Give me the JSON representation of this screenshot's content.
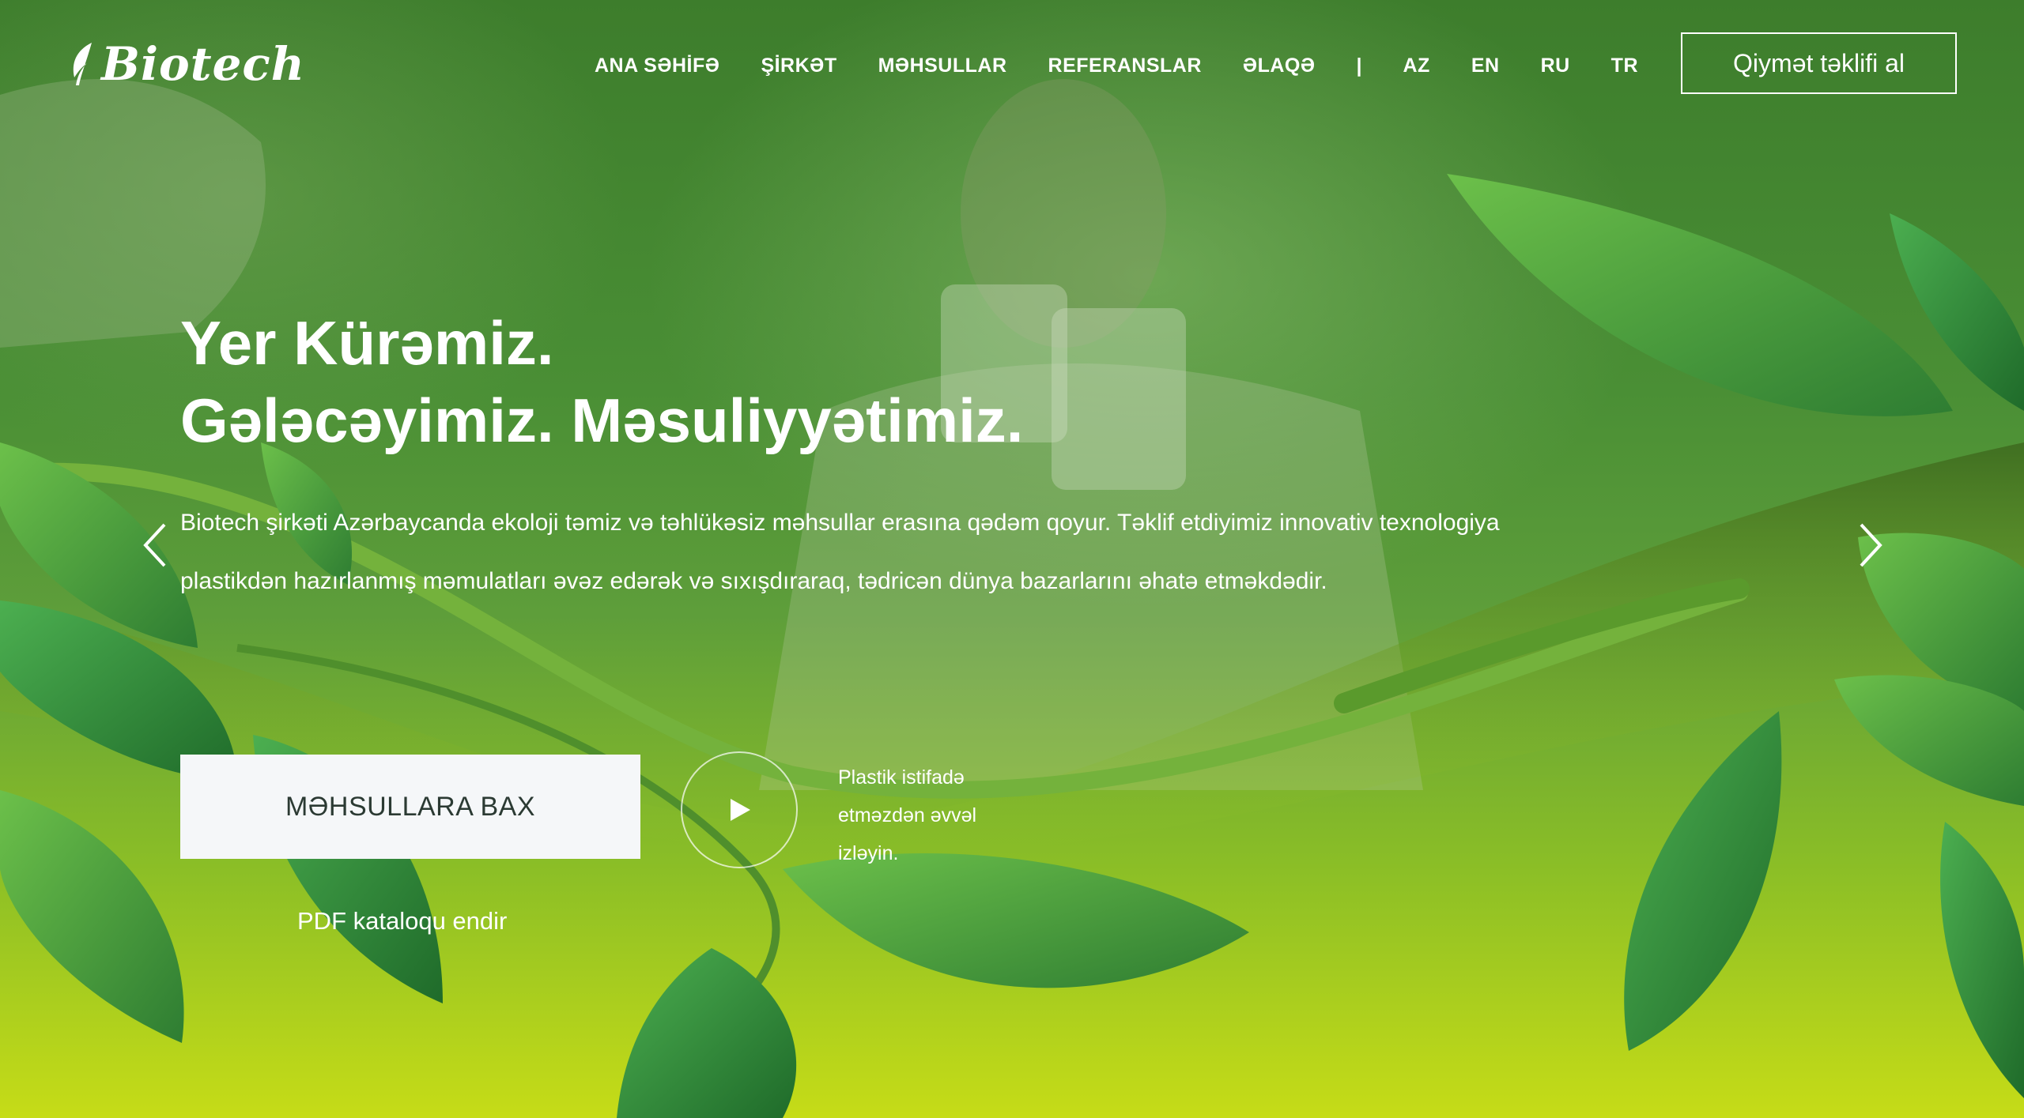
{
  "brand": {
    "name": "Biotech"
  },
  "nav": {
    "items": [
      "ANA SƏHİFƏ",
      "ŞİRKƏT",
      "MƏHSULLAR",
      "REFERANSLAR",
      "ƏLAQƏ"
    ],
    "separator": "|",
    "languages": [
      "AZ",
      "EN",
      "RU",
      "TR"
    ]
  },
  "header": {
    "quote_button": "Qiymət təklifi al"
  },
  "hero": {
    "title_line1": "Yer Kürəmiz.",
    "title_line2": "Gələcəyimiz. Məsuliyyətimiz.",
    "description": "Biotech şirkəti Azərbaycanda ekoloji təmiz və təhlükəsiz məhsullar erasına qədəm qoyur. Təklif etdiyimiz innovativ texnologiya plastikdən hazırlanmış məmulatları əvəz edərək və sıxışdıraraq, tədricən dünya bazarlarını əhatə etməkdədir.",
    "cta_button": "MƏHSULLARA BAX",
    "pdf_link": "PDF kataloqu endir",
    "video_text": [
      "Plastik istifadə",
      "etməzdən əvvəl",
      "izləyin."
    ]
  },
  "icons": {
    "logo": "leaf-icon",
    "prev": "chevron-left-icon",
    "next": "chevron-right-icon",
    "play": "play-icon"
  },
  "colors": {
    "bg_top": "#3d7d2c",
    "bg_bottom": "#c6dc17",
    "leaf_dark": "#2f7a33",
    "leaf_light": "#5fb33e",
    "cta_bg": "#f5f7f9",
    "cta_text": "#2b3a33"
  }
}
